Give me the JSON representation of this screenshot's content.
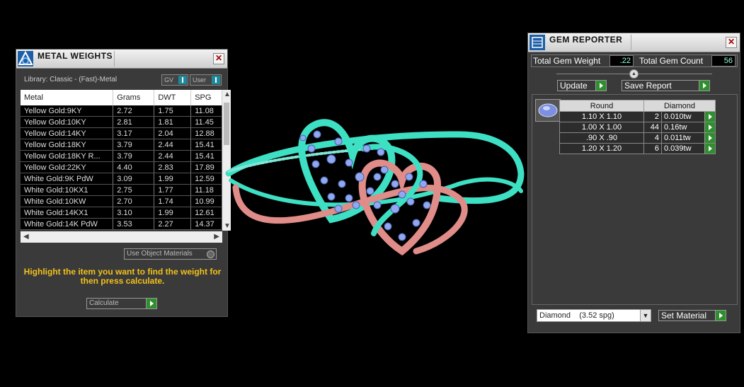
{
  "metal_weights": {
    "title": "METAL WEIGHTS",
    "close": "✕",
    "library": "Library: Classic - (Fast)-Metal",
    "toggle_gv": "GV",
    "toggle_user": "User",
    "columns": [
      "Metal",
      "Grams",
      "DWT",
      "SPG"
    ],
    "rows": [
      [
        "Yellow Gold:9KY",
        "2.72",
        "1.75",
        "11.08"
      ],
      [
        "Yellow Gold:10KY",
        "2.81",
        "1.81",
        "11.45"
      ],
      [
        "Yellow Gold:14KY",
        "3.17",
        "2.04",
        "12.88"
      ],
      [
        "Yellow Gold:18KY",
        "3.79",
        "2.44",
        "15.41"
      ],
      [
        "Yellow Gold:18KY R...",
        "3.79",
        "2.44",
        "15.41"
      ],
      [
        "Yellow Gold:22KY",
        "4.40",
        "2.83",
        "17.89"
      ],
      [
        "White Gold:9K PdW",
        "3.09",
        "1.99",
        "12.59"
      ],
      [
        "White Gold:10KX1",
        "2.75",
        "1.77",
        "11.18"
      ],
      [
        "White Gold:10KW",
        "2.70",
        "1.74",
        "10.99"
      ],
      [
        "White Gold:14KX1",
        "3.10",
        "1.99",
        "12.61"
      ],
      [
        "White Gold:14K PdW",
        "3.53",
        "2.27",
        "14.37"
      ]
    ],
    "use_object_materials": "Use Object Materials",
    "hint": "Highlight the item you want to find the weight for then press calculate.",
    "calculate": "Calculate"
  },
  "gem_reporter": {
    "title": "GEM REPORTER",
    "close": "✕",
    "total_weight_label": "Total Gem Weight",
    "total_weight_value": ".22",
    "total_count_label": "Total Gem Count",
    "total_count_value": "56",
    "update": "Update",
    "save_report": "Save Report",
    "table_headers": [
      "Round",
      "Diamond"
    ],
    "rows": [
      [
        "1.10 X 1.10",
        "2",
        "0.010tw"
      ],
      [
        "1.00 X 1.00",
        "44",
        "0.16tw"
      ],
      [
        ".90 X .90",
        "4",
        "0.011tw"
      ],
      [
        "1.20 X 1.20",
        "6",
        "0.039tw"
      ]
    ],
    "material_select": "Diamond    (3.52 spg)",
    "set_material": "Set Material"
  },
  "colors": {
    "panel_bg": "#3a3a3a",
    "ring_teal": "#3ee0c4",
    "ring_pink": "#e08c88",
    "gem_blue": "#8fa8f0",
    "hint_yellow": "#f2c21a",
    "go_green": "#2f8f2f"
  }
}
